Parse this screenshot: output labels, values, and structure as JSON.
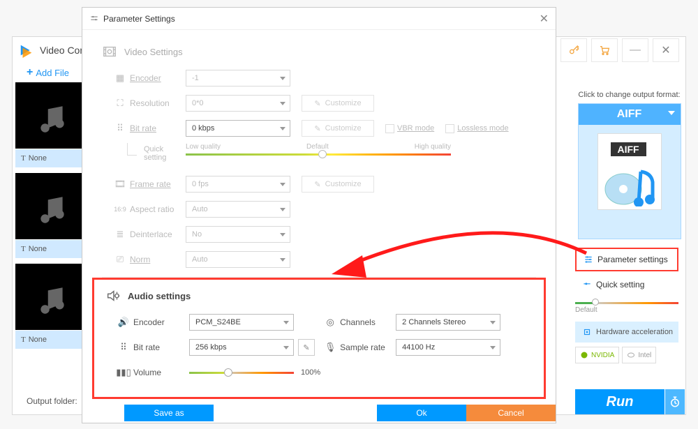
{
  "main": {
    "title": "Video Conv",
    "add_file": "Add File",
    "thumb_label": "None",
    "output_folder_label": "Output folder:"
  },
  "right": {
    "title": "Click to change output format:",
    "format": "AIFF",
    "format_icon_label": "AIFF",
    "param_settings": "Parameter settings",
    "quick_setting": "Quick setting",
    "quick_default": "Default",
    "hw_accel": "Hardware acceleration",
    "nvidia": "NVIDIA",
    "intel": "Intel",
    "run": "Run"
  },
  "dialog": {
    "title": "Parameter Settings",
    "video": {
      "section": "Video Settings",
      "encoder_lbl": "Encoder",
      "encoder_val": "-1",
      "resolution_lbl": "Resolution",
      "resolution_val": "0*0",
      "bitrate_lbl": "Bit rate",
      "bitrate_val": "0 kbps",
      "customize": "Customize",
      "vbr": "VBR mode",
      "lossless": "Lossless mode",
      "quick_setting": "Quick setting",
      "low": "Low quality",
      "default": "Default",
      "high": "High quality",
      "framerate_lbl": "Frame rate",
      "framerate_val": "0 fps",
      "aspect_lbl": "Aspect ratio",
      "aspect_val": "Auto",
      "deinterlace_lbl": "Deinterlace",
      "deinterlace_val": "No",
      "norm_lbl": "Norm",
      "norm_val": "Auto"
    },
    "audio": {
      "section": "Audio settings",
      "encoder_lbl": "Encoder",
      "encoder_val": "PCM_S24BE",
      "bitrate_lbl": "Bit rate",
      "bitrate_val": "256 kbps",
      "volume_lbl": "Volume",
      "volume_pct": "100%",
      "channels_lbl": "Channels",
      "channels_val": "2 Channels Stereo",
      "samplerate_lbl": "Sample rate",
      "samplerate_val": "44100 Hz"
    },
    "footer": {
      "save_as": "Save as",
      "ok": "Ok",
      "cancel": "Cancel"
    }
  }
}
